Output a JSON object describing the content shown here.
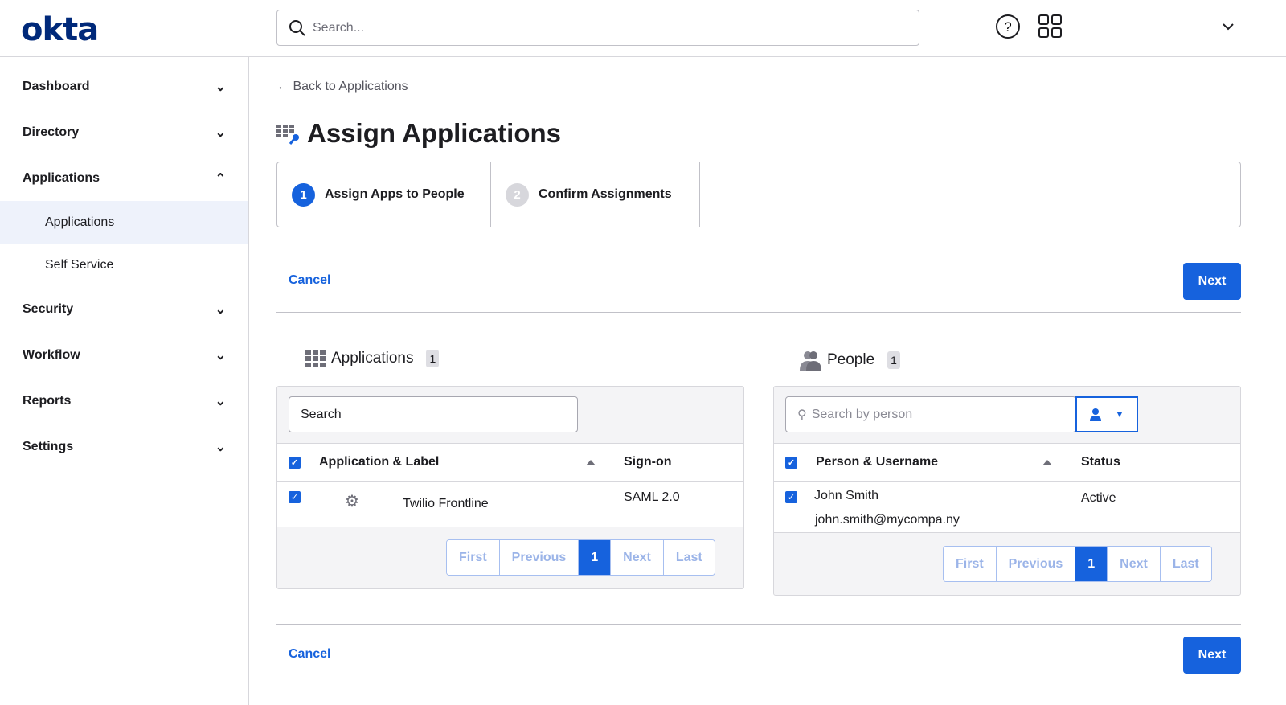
{
  "header": {
    "logo": "okta",
    "search_placeholder": "Search..."
  },
  "sidebar": {
    "items": [
      {
        "label": "Dashboard",
        "expanded": false
      },
      {
        "label": "Directory",
        "expanded": false
      },
      {
        "label": "Applications",
        "expanded": true,
        "children": [
          "Applications",
          "Self Service"
        ]
      },
      {
        "label": "Security",
        "expanded": false
      },
      {
        "label": "Workflow",
        "expanded": false
      },
      {
        "label": "Reports",
        "expanded": false
      },
      {
        "label": "Settings",
        "expanded": false
      }
    ]
  },
  "main": {
    "back": "← Back to Applications",
    "title": "Assign Applications",
    "steps": [
      {
        "num": "1",
        "label": "Assign Apps to People"
      },
      {
        "num": "2",
        "label": "Confirm Assignments"
      }
    ],
    "cancel": "Cancel",
    "next": "Next",
    "apps": {
      "title": "Applications",
      "count": "1",
      "search_value": "Search",
      "col1": "Application & Label",
      "col2": "Sign-on",
      "rows": [
        {
          "name": "Twilio Frontline",
          "signon": "SAML 2.0"
        }
      ]
    },
    "people": {
      "title": "People",
      "count": "1",
      "search_placeholder": "Search by person",
      "col1": "Person & Username",
      "col2": "Status",
      "rows": [
        {
          "name": "John Smith",
          "username": "john.smith@mycompa.ny",
          "status": "Active"
        }
      ]
    },
    "pager": {
      "first": "First",
      "previous": "Previous",
      "current": "1",
      "next": "Next",
      "last": "Last"
    }
  },
  "colors": {
    "accent": "#1662dd",
    "brand": "#00297a"
  }
}
